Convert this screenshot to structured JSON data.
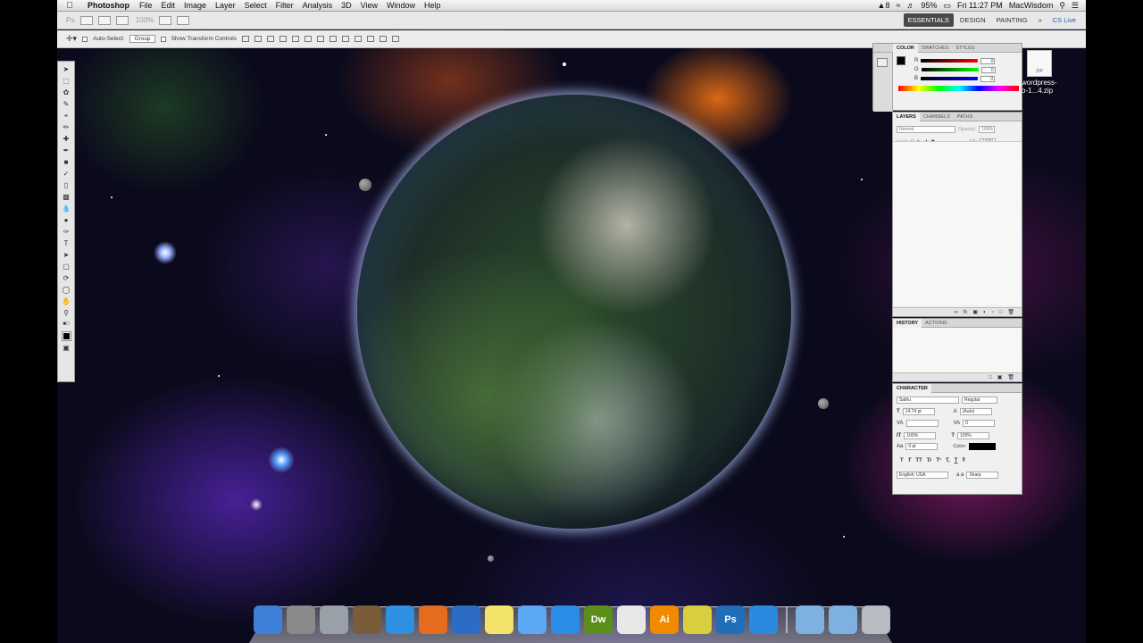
{
  "menubar": {
    "app_name": "Photoshop",
    "menus": [
      "File",
      "Edit",
      "Image",
      "Layer",
      "Select",
      "Filter",
      "Analysis",
      "3D",
      "View",
      "Window",
      "Help"
    ],
    "status": {
      "adobe_badge": "8",
      "battery": "95%",
      "clock": "Fri 11:27 PM",
      "user": "MacWisdom"
    }
  },
  "app_bar": {
    "logo": "Ps",
    "zoom": "100%",
    "workspaces": [
      "ESSENTIALS",
      "DESIGN",
      "PAINTING"
    ],
    "more": "»",
    "cs_live": "CS Live"
  },
  "options_bar": {
    "auto_select_label": "Auto-Select:",
    "auto_select_value": "Group",
    "show_transform_label": "Show Transform Controls"
  },
  "color_panel": {
    "tabs": [
      "COLOR",
      "SWATCHES",
      "STYLES"
    ],
    "channels": [
      {
        "label": "R",
        "value": "0"
      },
      {
        "label": "G",
        "value": "0"
      },
      {
        "label": "B",
        "value": "0"
      }
    ]
  },
  "layers_panel": {
    "tabs": [
      "LAYERS",
      "CHANNELS",
      "PATHS"
    ],
    "blend_mode": "Normal",
    "opacity_label": "Opacity:",
    "opacity_value": "100%",
    "lock_label": "Lock:",
    "fill_label": "Fill:",
    "fill_value": "100%"
  },
  "history_panel": {
    "tabs": [
      "HISTORY",
      "ACTIONS"
    ]
  },
  "character_panel": {
    "title": "CHARACTER",
    "font_family": "Sathu",
    "font_style": "Regular",
    "font_size": "14.74 pt",
    "leading": "(Auto)",
    "tracking": "0",
    "vertical_scale": "100%",
    "horizontal_scale": "100%",
    "baseline_shift": "0 pt",
    "color_label": "Color:",
    "styles": [
      "T",
      "T",
      "TT",
      "Tr",
      "T¹",
      "T,",
      "T",
      "Ŧ"
    ],
    "language": "English: USA",
    "antialias_label": "a a",
    "antialias": "Sharp"
  },
  "desktop": {
    "file_icon_label": "ZIP",
    "file_name_line1": "wordpress-",
    "file_name_line2": "o-1...4.zip"
  },
  "dock": {
    "apps": [
      {
        "name": "finder-icon",
        "label": "",
        "color": "#3d7fd9"
      },
      {
        "name": "system-preferences-icon",
        "label": "",
        "color": "#8a8a8a"
      },
      {
        "name": "launchpad-icon",
        "label": "",
        "color": "#9aa0a8"
      },
      {
        "name": "photo-booth-icon",
        "label": "",
        "color": "#7a5b3a"
      },
      {
        "name": "safari-icon",
        "label": "",
        "color": "#2f8fe0"
      },
      {
        "name": "firefox-icon",
        "label": "",
        "color": "#e56b1f"
      },
      {
        "name": "quicktime-icon",
        "label": "",
        "color": "#2c6cc7"
      },
      {
        "name": "stickies-icon",
        "label": "",
        "color": "#f3e36b"
      },
      {
        "name": "messages-icon",
        "label": "",
        "color": "#5aa9f2"
      },
      {
        "name": "app-store-icon",
        "label": "",
        "color": "#2a8ee8"
      },
      {
        "name": "dreamweaver-icon",
        "label": "Dw",
        "color": "#5a8f1c"
      },
      {
        "name": "acrobat-icon",
        "label": "",
        "color": "#e8e8e8"
      },
      {
        "name": "illustrator-icon",
        "label": "Ai",
        "color": "#f08a00"
      },
      {
        "name": "mail-icon",
        "label": "",
        "color": "#d7cf3e"
      },
      {
        "name": "photoshop-icon",
        "label": "Ps",
        "color": "#1e6fb8"
      },
      {
        "name": "itunes-icon",
        "label": "",
        "color": "#2a8ae0"
      }
    ],
    "stack_items": [
      {
        "name": "applications-folder-icon",
        "color": "#7fb1e0"
      },
      {
        "name": "documents-folder-icon",
        "color": "#7fb1e0"
      },
      {
        "name": "trash-icon",
        "color": "#b8bcc2"
      }
    ]
  }
}
